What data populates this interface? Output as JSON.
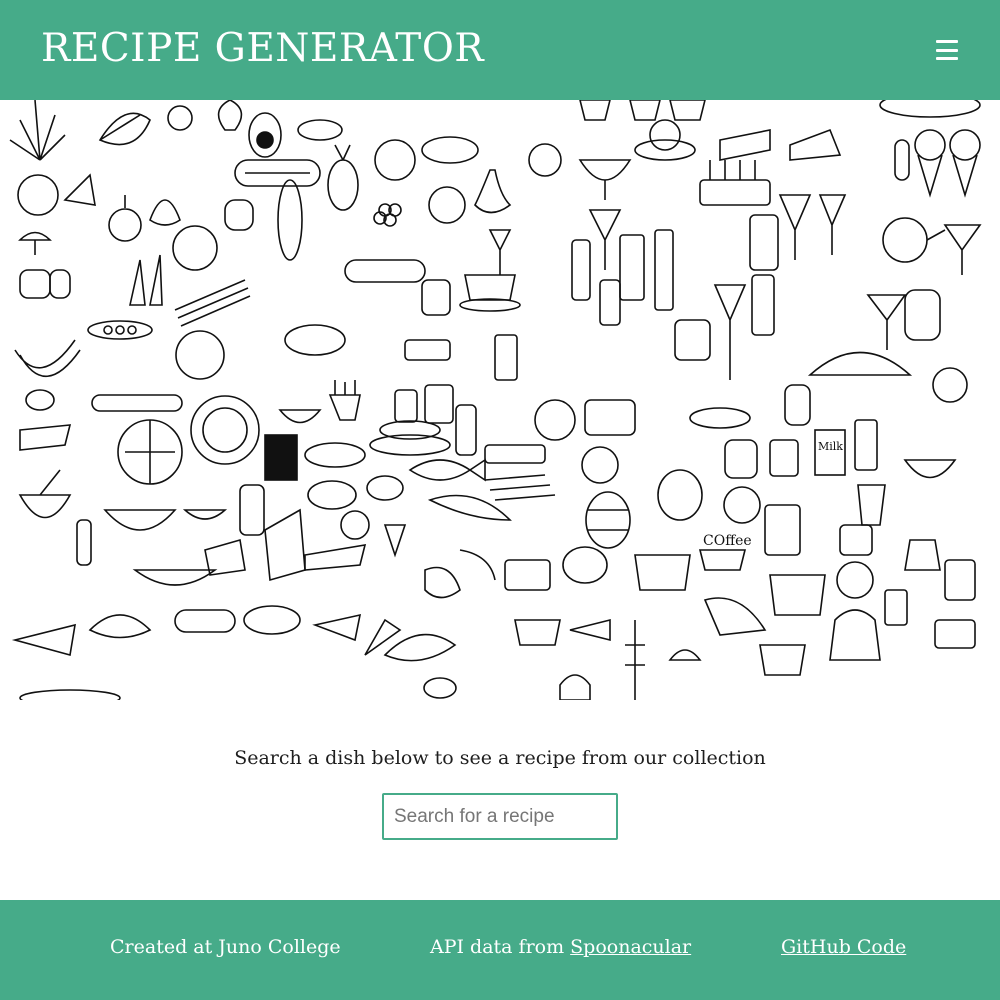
{
  "header": {
    "title": "RECIPE GENERATOR",
    "menu_icon": "hamburger-menu-icon"
  },
  "hero": {
    "image": "food-doodle-collage",
    "coffee_word": "COffee",
    "milk_word": "Milk"
  },
  "search": {
    "prompt": "Search a dish below to see a recipe from our collection",
    "placeholder": "Search for a recipe",
    "value": ""
  },
  "footer": {
    "created_text": "Created at Juno College",
    "api_prefix": "API data from ",
    "api_link": "Spoonacular",
    "github_link": "GitHub Code"
  },
  "colors": {
    "brand": "#46ab89",
    "text": "#1e1e1e",
    "white": "#ffffff"
  }
}
